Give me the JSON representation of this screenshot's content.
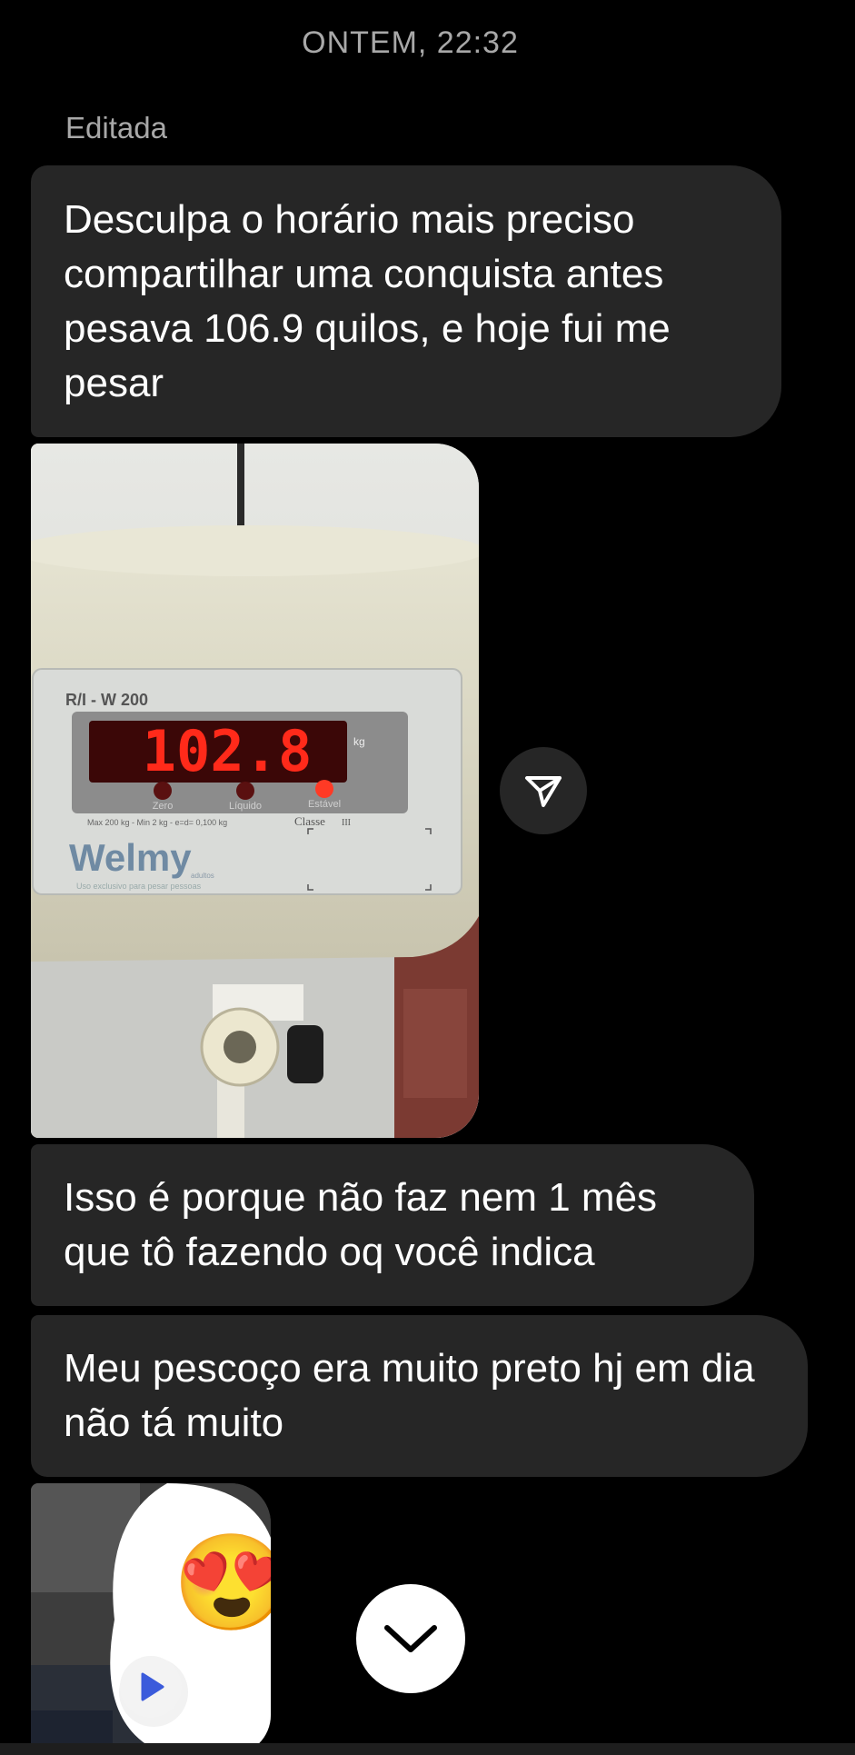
{
  "header": {
    "timestamp": "ONTEM, 22:32",
    "edited_label": "Editada"
  },
  "messages": [
    {
      "text": "Desculpa o horário mais preciso compartilhar uma conquista antes pesava 106.9 quilos, e hoje fui me pesar"
    },
    {
      "text": "Isso é porque não faz nem 1 mês que tô fazendo oq você indica"
    },
    {
      "text": "Meu pescoço era muito preto hj em dia não tá muito"
    }
  ],
  "scale_photo": {
    "model": "R/I - W 200",
    "display_value": "102.8",
    "unit": "kg",
    "indicator_labels": [
      "Zero",
      "Líquido",
      "Estável"
    ],
    "spec_text": "Max 200 kg - Min 2 kg - e=d= 0,100 kg",
    "class_text": "Classe",
    "class_mark": "III",
    "brand": "Welmy",
    "brand_sub": "adultos",
    "usage_text": "Uso exclusivo para pesar pessoas"
  },
  "video_reply": {
    "emoji": "😍"
  },
  "icons": {
    "share": "paper-plane-icon",
    "scroll_down": "chevron-down-icon",
    "play": "play-icon"
  },
  "colors": {
    "background": "#000000",
    "bubble": "#262626",
    "muted_text": "#a8a8a8",
    "play_blue": "#3b5bdb",
    "led_red": "#ff2a1a"
  }
}
